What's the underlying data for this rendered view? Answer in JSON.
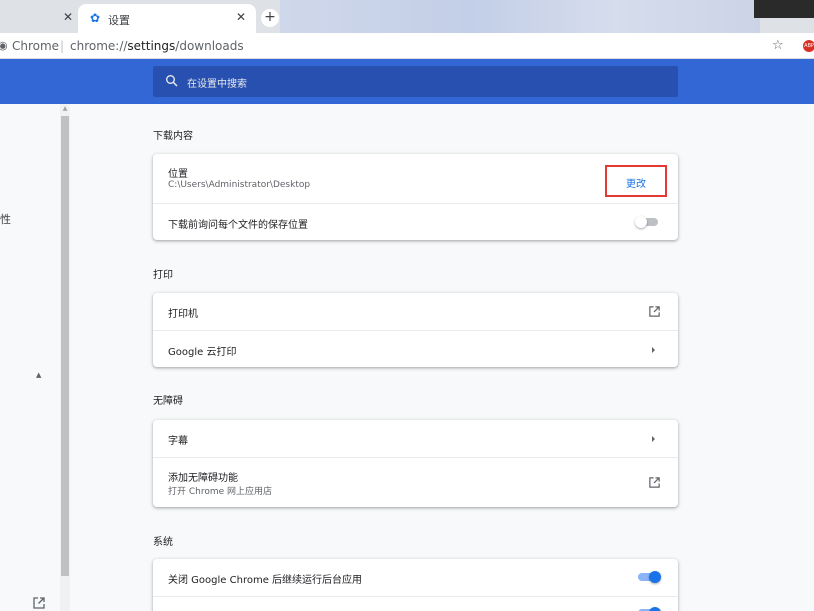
{
  "tabs": {
    "active_title": "设置"
  },
  "omnibox": {
    "site_chip": "Chrome",
    "separator": "|",
    "url_prefix": "chrome://",
    "url_path": "settings",
    "url_suffix": "/downloads"
  },
  "search": {
    "placeholder": "在设置中搜索"
  },
  "sidebar": {
    "partial_label": "性"
  },
  "sections": {
    "downloads": {
      "title": "下载内容",
      "location_label": "位置",
      "location_value": "C:\\Users\\Administrator\\Desktop",
      "change_button": "更改",
      "ask_label": "下载前询问每个文件的保存位置",
      "ask_enabled": false
    },
    "print": {
      "title": "打印",
      "printers_label": "打印机",
      "cloud_print_label": "Google 云打印"
    },
    "accessibility": {
      "title": "无障碍",
      "captions_label": "字幕",
      "add_features_label": "添加无障碍功能",
      "add_features_sub": "打开 Chrome 网上应用店"
    },
    "system": {
      "title": "系统",
      "background_apps_label": "关闭 Google Chrome 后继续运行后台应用",
      "background_apps_enabled": true,
      "second_row_enabled": true
    }
  },
  "colors": {
    "header": "#3367d6",
    "accent": "#1a73e8",
    "highlight_box": "#e53935"
  }
}
